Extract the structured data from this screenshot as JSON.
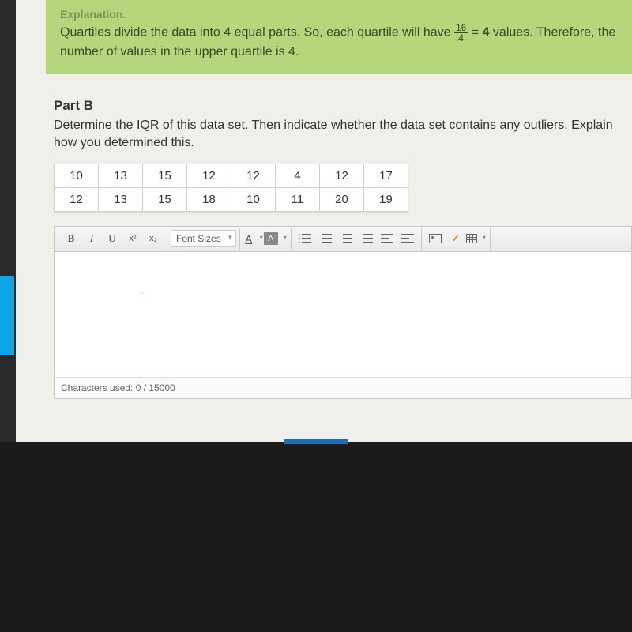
{
  "explanation": {
    "title": "Explanation.",
    "line1_a": "Quartiles divide the data into 4 equal parts. So, each quartile will have ",
    "frac_num": "16",
    "frac_den": "4",
    "line1_b": " = ",
    "result": "4",
    "line1_c": " values. Therefore, the",
    "line2": "number of values in the upper quartile is 4."
  },
  "partB": {
    "title": "Part B",
    "prompt": "Determine the IQR of this data set. Then indicate whether the data set contains any outliers. Explain how you determined this.",
    "data": {
      "row1": [
        "10",
        "13",
        "15",
        "12",
        "12",
        "4",
        "12",
        "17"
      ],
      "row2": [
        "12",
        "13",
        "15",
        "18",
        "10",
        "11",
        "20",
        "19"
      ]
    }
  },
  "toolbar": {
    "bold": "B",
    "italic": "I",
    "underline": "U",
    "sup": "x²",
    "sub": "x₂",
    "fontSizes": "Font Sizes",
    "textColor": "A",
    "bgColor": "A",
    "check": "✓"
  },
  "editor": {
    "charCountLabel": "Characters used: ",
    "charCountValue": "0 / 15000"
  }
}
